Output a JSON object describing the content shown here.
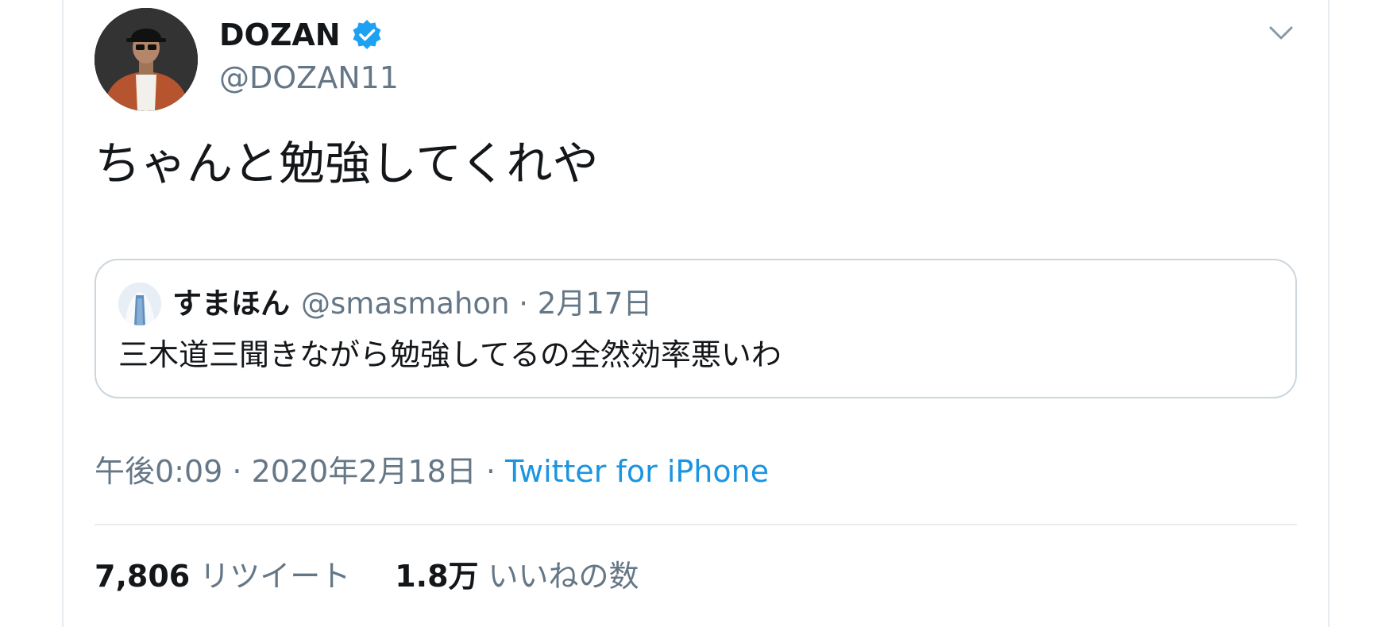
{
  "tweet": {
    "author": {
      "display_name": "DOZAN",
      "handle": "@DOZAN11",
      "verified": true,
      "avatar_icon": "profile-photo"
    },
    "menu_icon": "chevron-down-icon",
    "text": "ちゃんと勉強してくれや",
    "quoted": {
      "display_name": "すまほん",
      "meta": "@smasmahon · 2月17日",
      "text": "三木道三聞きながら勉強してるの全然効率悪いわ"
    },
    "timestamp": "午後0:09 · 2020年2月18日 ·",
    "source": "Twitter for iPhone",
    "stats": {
      "retweets_count": "7,806",
      "retweets_label": "リツイート",
      "likes_count": "1.8万",
      "likes_label": "いいねの数"
    }
  },
  "colors": {
    "text_primary": "#14171a",
    "text_secondary": "#657786",
    "link": "#1b95e0",
    "verified_badge": "#1da1f2",
    "border": "#ccd6dd"
  }
}
